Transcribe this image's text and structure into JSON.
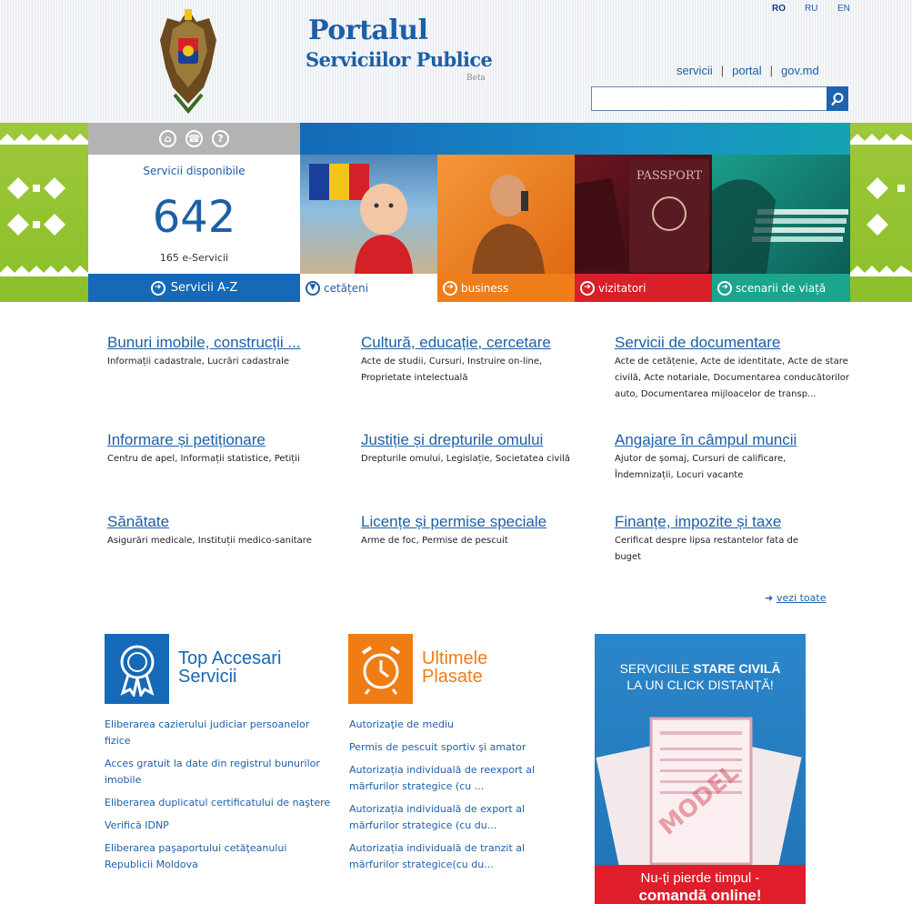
{
  "header": {
    "brand_line1": "Portalul",
    "brand_line2": "Serviciilor Publice",
    "beta": "Beta",
    "languages": [
      "RO",
      "RU",
      "EN"
    ],
    "top_links": [
      "servicii",
      "portal",
      "gov.md"
    ],
    "search_value": ""
  },
  "banner": {
    "stats_label": "Servicii disponibile",
    "services_count": "642",
    "eservices": "165 e-Servicii",
    "az_button": "Servicii A-Z",
    "tiles": [
      {
        "label": "cetățeni",
        "color": "#ffffff"
      },
      {
        "label": "business",
        "color": "#ef7d1a"
      },
      {
        "label": "vizitatori",
        "color": "#d81f2a"
      },
      {
        "label": "scenarii de viață",
        "color": "#1aa58c"
      }
    ],
    "passport_text": "PASSPORT"
  },
  "categories": [
    {
      "title": "Bunuri imobile, construcții ...",
      "desc": "Informații cadastrale, Lucrări cadastrale"
    },
    {
      "title": "Cultură, educație, cercetare",
      "desc": "Acte de studii, Cursuri, Instruire on-line, Proprietate intelectuală"
    },
    {
      "title": "Servicii de documentare",
      "desc": "Acte de cetățenie, Acte de identitate, Acte de stare civilă, Acte notariale, Documentarea conducătorilor auto, Documentarea mijloacelor de transp..."
    },
    {
      "title": "Informare și petiționare",
      "desc": "Centru de apel, Informații statistice, Petiții"
    },
    {
      "title": "Justiție și drepturile omului",
      "desc": "Drepturile omului, Legislație, Societatea civilă"
    },
    {
      "title": "Angajare în câmpul muncii",
      "desc": "Ajutor de șomaj, Cursuri de calificare, Îndemnizații, Locuri vacante"
    },
    {
      "title": "Sănătate",
      "desc": "Asigurări medicale, Instituții medico-sanitare"
    },
    {
      "title": "Licențe și permise speciale",
      "desc": "Arme de foc, Permise de pescuit"
    },
    {
      "title": "Finanțe, impozite și taxe",
      "desc": "Cerificat despre lipsa restantelor fata de buget"
    }
  ],
  "see_all": "vezi toate",
  "top_section": {
    "title_line1": "Top Accesari",
    "title_line2": "Servicii",
    "color": "#1569b6",
    "items": [
      "Eliberarea cazierului judiciar persoanelor fizice",
      "Acces gratuit la date din registrul bunurilor imobile",
      "Eliberarea duplicatul certificatului de naştere",
      "Verifică IDNP",
      "Eliberarea paşaportului cetăţeanului Republicii Moldova"
    ]
  },
  "latest_section": {
    "title_line1": "Ultimele",
    "title_line2": "Plasate",
    "color": "#f07d14",
    "items": [
      "Autorizaţie de mediu",
      "Permis de pescuit sportiv şi amator",
      "Autorizația individuală de reexport al mărfurilor strategice (cu ...",
      "Autorizația individuală de export al mărfurilor strategice (cu du...",
      "Autorizația individuală de tranzit al mărfurilor strategice(cu du..."
    ]
  },
  "ad": {
    "line1_prefix": "SERVICIILE",
    "line1_bold": "STARE CIVILĂ",
    "line2": "LA UN CLICK DISTANȚĂ!",
    "stamp": "MODEL",
    "footer_line1": "Nu-ți pierde timpul -",
    "footer_line2": "comandă online!"
  }
}
